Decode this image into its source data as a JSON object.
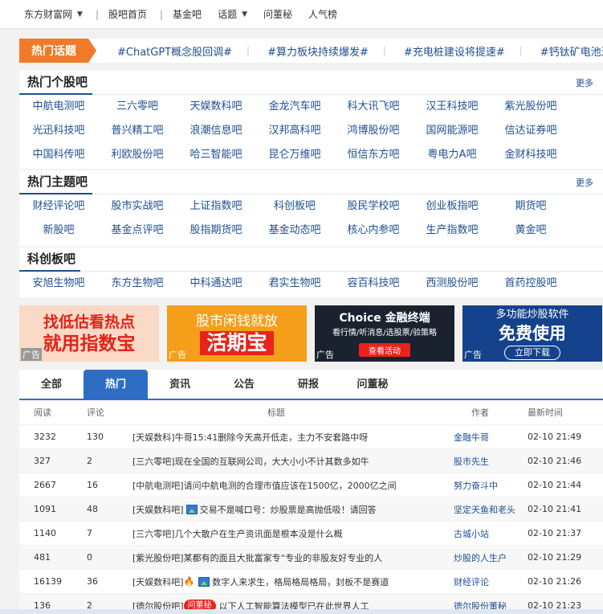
{
  "topnav": {
    "items": [
      {
        "label": "东方财富网",
        "caret": true
      },
      {
        "label": "股吧首页",
        "caret": false
      },
      {
        "label": "基金吧",
        "caret": false
      },
      {
        "label": "话题",
        "caret": true
      },
      {
        "label": "问董秘",
        "caret": false
      },
      {
        "label": "人气榜",
        "caret": false
      }
    ]
  },
  "hot_topics": {
    "tag": "热门话题",
    "topics": [
      "#ChatGPT概念股回调#",
      "#算力板块持续爆发#",
      "#充电桩建设将提速#",
      "#钙钛矿电池进程提速#"
    ]
  },
  "hot_stocks": {
    "title": "热门个股吧",
    "more": "更多",
    "items": [
      "中航电测吧",
      "三六零吧",
      "天娱数科吧",
      "金龙汽车吧",
      "科大讯飞吧",
      "汉王科技吧",
      "紫光股份吧",
      "光迅科技吧",
      "普兴精工吧",
      "浪潮信息吧",
      "汉邦高科吧",
      "鸿博股份吧",
      "国网能源吧",
      "信达证券吧",
      "中国科传吧",
      "利欧股份吧",
      "哈三智能吧",
      "昆仑万维吧",
      "恒信东方吧",
      "粤电力A吧",
      "金财科技吧"
    ]
  },
  "hot_themes": {
    "title": "热门主题吧",
    "more": "更多",
    "items": [
      "财经评论吧",
      "股市实战吧",
      "上证指数吧",
      "科创板吧",
      "股民学校吧",
      "创业板指吧",
      "期货吧",
      "新股吧",
      "基金点评吧",
      "股指期货吧",
      "基金动态吧",
      "核心内参吧",
      "生产指数吧",
      "黄金吧"
    ]
  },
  "star_board": {
    "title": "科创板吧",
    "items": [
      "安旭生物吧",
      "东方生物吧",
      "中科通达吧",
      "君实生物吧",
      "容百科技吧",
      "西测股份吧",
      "首药控股吧"
    ]
  },
  "ads": {
    "tag": "广告",
    "ad1": {
      "l1": "找低估看热点",
      "l2": "就用指数宝"
    },
    "ad2": {
      "l1": "股市闲钱就放",
      "l2": "活期宝"
    },
    "ad3": {
      "l1": "Choice 金融终端",
      "l2": "看行情/听消息/选股票/验策略",
      "btn": "查看活动"
    },
    "ad4": {
      "l1": "多功能炒股软件",
      "l2": "免费使用",
      "btn": "立即下载"
    }
  },
  "tabs": [
    "全部",
    "热门",
    "资讯",
    "公告",
    "研报",
    "问董秘"
  ],
  "active_tab": "热门",
  "list": {
    "headers": [
      "阅读",
      "评论",
      "标题",
      "作者",
      "最新时间"
    ],
    "rows": [
      {
        "reads": "3232",
        "comments": "130",
        "bar": "[天娱数科]",
        "title": "牛哥15:41删除今天高开低走，主力不安套路中呀",
        "author": "金融牛哥",
        "time": "02-10 21:49",
        "img": false,
        "fire": false,
        "badge": ""
      },
      {
        "reads": "327",
        "comments": "2",
        "bar": "[三六零吧]",
        "title": "现在全国的互联网公司，大大小小不计其数多如牛",
        "author": "股市先生",
        "time": "02-10 21:46",
        "img": false,
        "fire": false,
        "badge": ""
      },
      {
        "reads": "2667",
        "comments": "16",
        "bar": "[中航电测吧]",
        "title": "请问中航电测的合理市值应该在1500亿，2000亿之间",
        "author": "努力奋斗中",
        "time": "02-10 21:44",
        "img": false,
        "fire": false,
        "badge": ""
      },
      {
        "reads": "1091",
        "comments": "48",
        "bar": "[天娱数科吧]",
        "title": "交易不是喊口号：炒股票是高抛低吸！请回答",
        "author": "坚定天鱼和老头",
        "time": "02-10 21:41",
        "img": true,
        "fire": false,
        "badge": ""
      },
      {
        "reads": "1140",
        "comments": "7",
        "bar": "[三六零吧]",
        "title": "几个大散户在生产资讯面是根本没是什么概",
        "author": "古城小站",
        "time": "02-10 21:37",
        "img": false,
        "fire": false,
        "badge": ""
      },
      {
        "reads": "481",
        "comments": "0",
        "bar": "[紫光股份吧]",
        "title": "某都有的面且大批富家专“专业的非股友好专业的人",
        "author": "炒股的人生户",
        "time": "02-10 21:29",
        "img": false,
        "fire": false,
        "badge": ""
      },
      {
        "reads": "16139",
        "comments": "36",
        "bar": "[天娱数科吧]",
        "title": "数字人来求生，格局格局格局，封板不是赛道",
        "author": "财经评论",
        "time": "02-10 21:26",
        "img": true,
        "fire": true,
        "badge": ""
      },
      {
        "reads": "136",
        "comments": "2",
        "bar": "[德尔股份吧]",
        "title": "以下人工智能算法模型已在此世界人工",
        "author": "德尔股份董秘",
        "time": "02-10 21:23",
        "img": false,
        "fire": false,
        "badge": "问董秘"
      }
    ]
  },
  "colors": {
    "accent": "#2d6ec4",
    "orange": "#f07a29",
    "link": "#1d4f91",
    "red": "#e8231a"
  }
}
